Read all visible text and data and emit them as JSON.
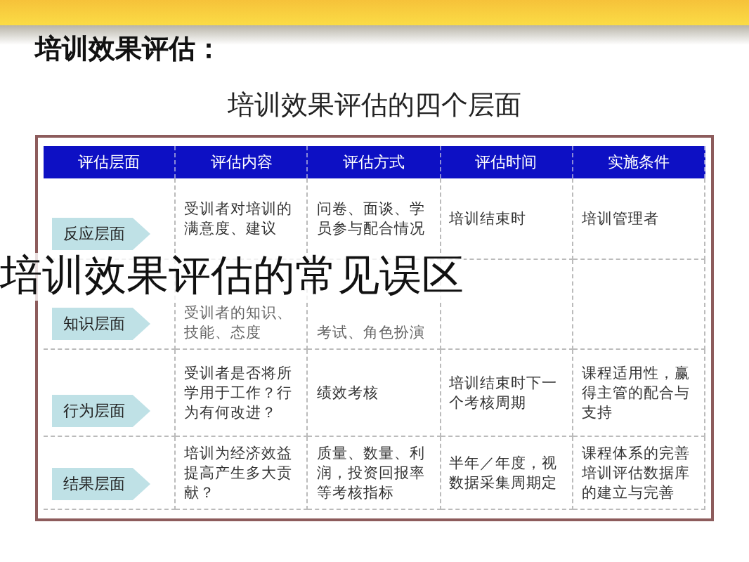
{
  "slide": {
    "heading": "培训效果评估：",
    "subtitle": "培训效果评估的四个层面",
    "table": {
      "columns": [
        "评估层面",
        "评估内容",
        "评估方式",
        "评估时间",
        "实施条件"
      ],
      "rows": [
        {
          "level": "反应层面",
          "content": "受训者对培训的满意度、建议",
          "method": "问卷、面谈、学员参与配合情况",
          "time": "培训结束时",
          "conditions": "培训管理者"
        },
        {
          "level": "知识层面",
          "content": "受训者的知识、技能、态度",
          "method": "考试、角色扮演"
        },
        {
          "level": "行为层面",
          "content": "受训者是否将所学用于工作？行为有何改进？",
          "method": "绩效考核",
          "time": "培训结束时下一个考核周期",
          "conditions": "课程适用性，赢得主管的配合与支持"
        },
        {
          "level": "结果层面",
          "content": "培训为经济效益提高产生多大贡献？",
          "method": "质量、数量、利润，投资回报率等考核指标",
          "time": "半年／年度，视数据采集周期定",
          "conditions": "课程体系的完善培训评估数据库的建立与完善"
        }
      ]
    }
  },
  "overlay_title": "培训效果评估的常见误区"
}
